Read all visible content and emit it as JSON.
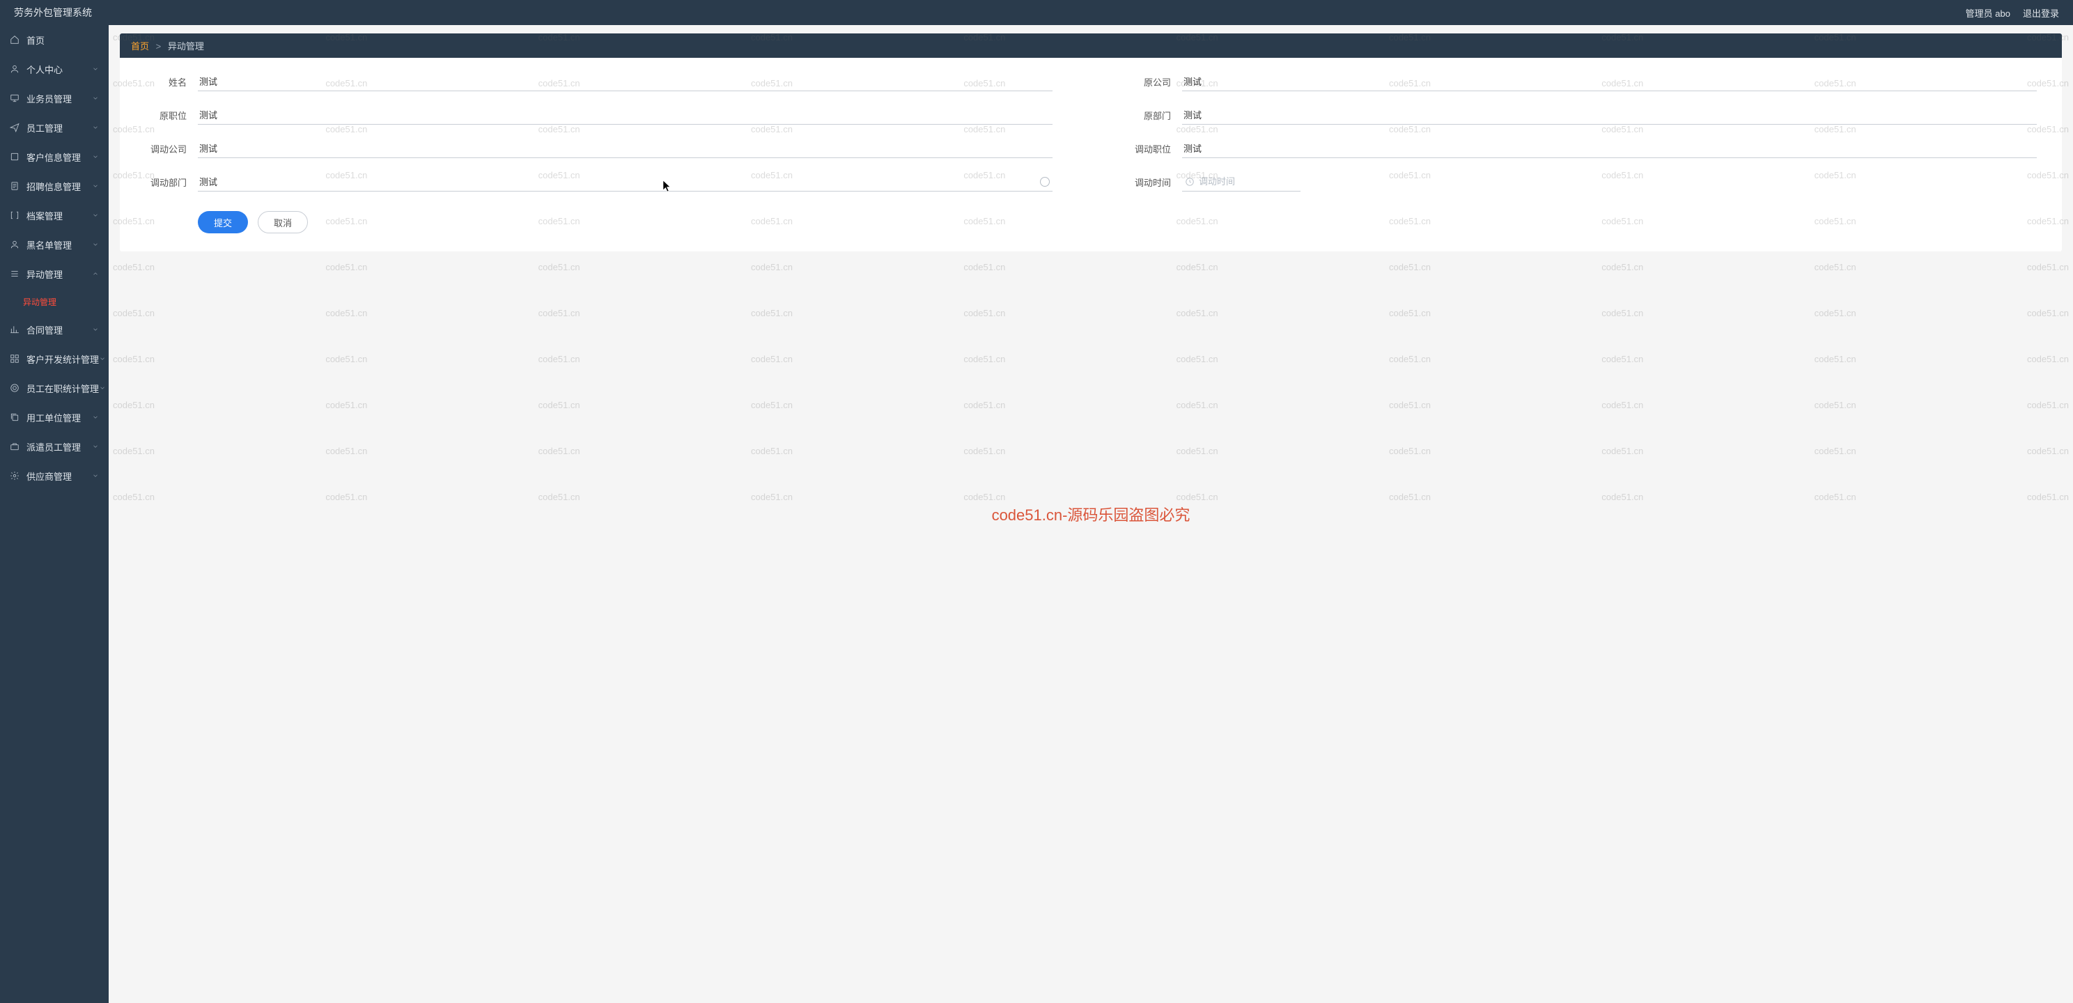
{
  "header": {
    "system_name": "劳务外包管理系统",
    "admin_label": "管理员 abo",
    "logout_label": "退出登录"
  },
  "sidebar": {
    "items": [
      {
        "label": "首页",
        "icon": "home",
        "expand": false
      },
      {
        "label": "个人中心",
        "icon": "user",
        "expand": true
      },
      {
        "label": "业务员管理",
        "icon": "monitor",
        "expand": true
      },
      {
        "label": "员工管理",
        "icon": "plane",
        "expand": true
      },
      {
        "label": "客户信息管理",
        "icon": "square",
        "expand": true
      },
      {
        "label": "招聘信息管理",
        "icon": "doc",
        "expand": true
      },
      {
        "label": "档案管理",
        "icon": "brackets",
        "expand": true
      },
      {
        "label": "黑名单管理",
        "icon": "user",
        "expand": true
      },
      {
        "label": "异动管理",
        "icon": "list",
        "expand": true,
        "open": true,
        "sub": [
          {
            "label": "异动管理",
            "active": true
          }
        ]
      },
      {
        "label": "合同管理",
        "icon": "chart",
        "expand": true
      },
      {
        "label": "客户开发统计管理",
        "icon": "grid",
        "expand": true
      },
      {
        "label": "员工在职统计管理",
        "icon": "target",
        "expand": true
      },
      {
        "label": "用工单位管理",
        "icon": "copy",
        "expand": true
      },
      {
        "label": "派遣员工管理",
        "icon": "briefcase",
        "expand": true
      },
      {
        "label": "供应商管理",
        "icon": "settings",
        "expand": true
      }
    ]
  },
  "breadcrumb": {
    "home": "首页",
    "sep": ">",
    "current": "异动管理"
  },
  "form": {
    "labels": {
      "name": "姓名",
      "orig_company": "原公司",
      "orig_position": "原职位",
      "orig_dept": "原部门",
      "move_company": "调动公司",
      "move_position": "调动职位",
      "move_dept": "调动部门",
      "move_time": "调动时间"
    },
    "values": {
      "name": "测试",
      "orig_company": "测试",
      "orig_position": "测试",
      "orig_dept": "测试",
      "move_company": "测试",
      "move_position": "测试",
      "move_dept": "测试",
      "move_time": ""
    },
    "placeholders": {
      "move_time": "调动时间"
    },
    "submit_label": "提交",
    "cancel_label": "取消"
  },
  "watermark": {
    "text": "code51.cn",
    "center": "code51.cn-源码乐园盗图必究"
  }
}
